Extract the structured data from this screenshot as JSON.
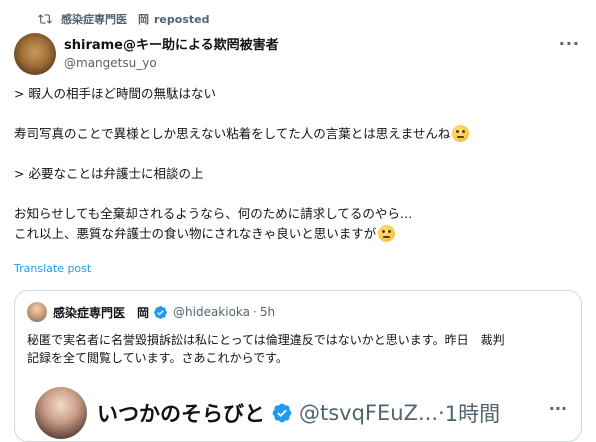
{
  "repost": {
    "user": "感染症専門医　岡",
    "label": "reposted"
  },
  "post": {
    "display_name": "shirame@キー助による欺罔被害者",
    "handle": "@mangetsu_yo",
    "more": "···",
    "lines": [
      "> 暇人の相手ほど時間の無駄はない",
      "",
      "寿司写真のことで異様としか思えない粘着をしてた人の言葉とは思えませんね",
      "",
      "> 必要なことは弁護士に相談の上",
      "",
      "お知らせしても全棄却されるようなら、何のために請求してるのやら…",
      "これ以上、悪質な弁護士の食い物にされなきゃ良いと思いますが"
    ],
    "translate": "Translate post"
  },
  "quote": {
    "display_name": "感染症専門医　岡",
    "handle": "@hideakioka",
    "dot": "·",
    "time": "5h",
    "text_line1": "秘匿で実名者に名誉毀損訴訟は私にとっては倫理違反ではないかと思います。昨日　裁判",
    "text_line2": "記録を全て閲覧しています。さあこれからです。",
    "embed": {
      "display_name": "いつかのそらびと",
      "handle": "@tsvqFEuZ...",
      "dot": "·",
      "time": "1時間",
      "more": "···"
    }
  },
  "colors": {
    "accent": "#1d9bf0",
    "text": "#0f1419",
    "muted": "#536471",
    "border": "#cfd9de"
  }
}
